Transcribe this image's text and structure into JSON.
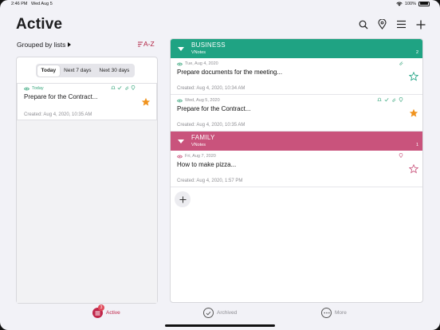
{
  "status_bar": {
    "time": "2:46 PM",
    "date": "Wed Aug 5",
    "battery": "100%"
  },
  "header": {
    "title": "Active"
  },
  "toolbar_icons": [
    "search-icon",
    "location-pin-icon",
    "menu-icon",
    "plus-icon"
  ],
  "grouping": {
    "label": "Grouped by lists",
    "sort_label": "A-Z"
  },
  "date_filter": {
    "tabs": [
      "Today",
      "Next 7 days",
      "Next 30 days"
    ],
    "selected": "Today"
  },
  "left_note": {
    "date": "Today",
    "title": "Prepare for the Contract...",
    "created": "Created: Aug 4, 2020, 10:35 AM",
    "starred": true
  },
  "groups": [
    {
      "name": "BUSINESS",
      "source": "VNotes",
      "count": "2",
      "color": "#1fa383",
      "notes": [
        {
          "date": "Tue, Aug 4, 2020",
          "title": "Prepare documents for the meeting...",
          "created": "Created: Aug 4, 2020, 10:34 AM",
          "starred": false
        },
        {
          "date": "Wed, Aug 5, 2020",
          "title": "Prepare for the Contract...",
          "created": "Created: Aug 4, 2020, 10:35 AM",
          "starred": true
        }
      ]
    },
    {
      "name": "FAMILY",
      "source": "VNotes",
      "count": "1",
      "color": "#c9537c",
      "notes": [
        {
          "date": "Fri, Aug 7, 2020",
          "title": "How to make pizza...",
          "created": "Created: Aug 4, 2020, 1:57 PM",
          "starred": false
        }
      ]
    }
  ],
  "tabbar": {
    "active": {
      "label": "Active",
      "badge": "3"
    },
    "archived": {
      "label": "Archived"
    },
    "more": {
      "label": "More"
    }
  },
  "colors": {
    "accent": "#c0264a",
    "star": "#f0931e",
    "business": "#1fa383",
    "family": "#c9537c"
  }
}
